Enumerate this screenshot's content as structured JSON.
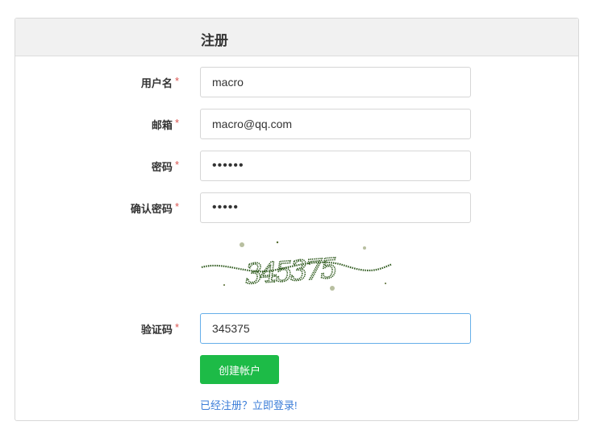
{
  "header": {
    "title": "注册"
  },
  "form": {
    "username": {
      "label": "用户名",
      "required_mark": "*",
      "value": "macro"
    },
    "email": {
      "label": "邮箱",
      "required_mark": "*",
      "value": "macro@qq.com"
    },
    "password": {
      "label": "密码",
      "required_mark": "*",
      "value": "••••••"
    },
    "confirm_password": {
      "label": "确认密码",
      "required_mark": "*",
      "value": "•••••"
    },
    "captcha_image": {
      "text": "345375"
    },
    "captcha": {
      "label": "验证码",
      "required_mark": "*",
      "value": "345375"
    },
    "submit_label": "创建帐户",
    "login_link": "已经注册？立即登录!"
  },
  "colors": {
    "button": "#1dbb47",
    "link": "#3b7dd8",
    "required": "#d9534f",
    "captcha_text": "#2f5a1e"
  }
}
